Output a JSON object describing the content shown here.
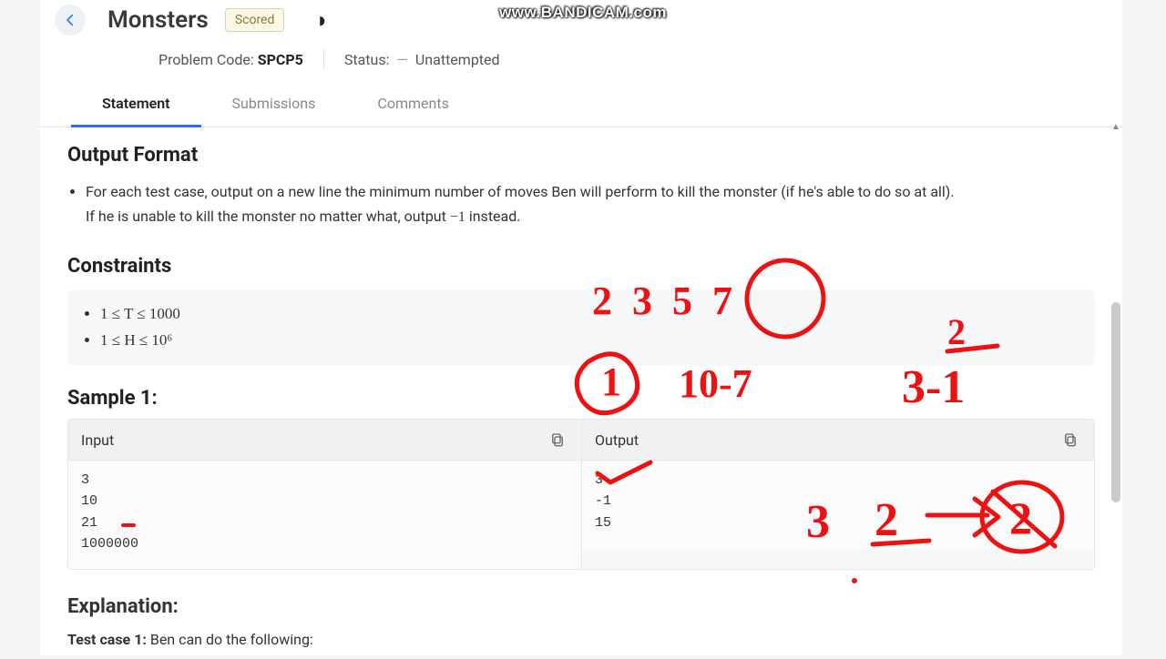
{
  "watermark": "www.BANDICAM.com",
  "header": {
    "title": "Monsters",
    "badge": "Scored",
    "code_label": "Problem Code: ",
    "code_value": "SPCP5",
    "status_label": "Status:",
    "status_value": "Unattempted"
  },
  "tabs": {
    "statement": "Statement",
    "submissions": "Submissions",
    "comments": "Comments"
  },
  "output_format": {
    "heading": "Output Format",
    "line1": "For each test case, output on a new line the minimum number of moves Ben will perform to kill the monster (if he's able to do so at all).",
    "line2_a": "If he is unable to kill the monster no matter what, output ",
    "line2_neg1": "−1",
    "line2_b": " instead."
  },
  "constraints": {
    "heading": "Constraints",
    "c1": "1 ≤ T ≤ 1000",
    "c2": "1 ≤ H ≤ 10⁶"
  },
  "sample": {
    "title": "Sample 1:",
    "input_label": "Input",
    "output_label": "Output",
    "input_text": "3\n10\n21\n1000000",
    "output_text": "3\n-1\n15"
  },
  "explanation": {
    "heading": "Explanation:",
    "tc_label": "Test case ",
    "tc_num": "1:",
    "tc_rest": " Ben can do the following:"
  },
  "annotations": {
    "primes": "2 3 5 7",
    "circled_prime": "7",
    "step1_label": "1",
    "step1_expr": "10-7",
    "two_small": "2",
    "step2_expr": "3-1",
    "bottom_seq_a": "3",
    "bottom_seq_b": "2",
    "bottom_circ": "2",
    "check_on_output": "3"
  }
}
